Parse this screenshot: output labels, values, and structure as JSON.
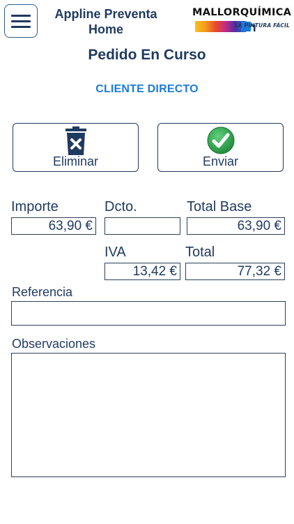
{
  "header": {
    "menu_icon": "hamburger-menu-icon",
    "app_title": "Appline Preventa Home",
    "logo": {
      "name": "MALLORQUÍMICA",
      "tagline": "LA PINTURA FÁCIL"
    }
  },
  "page_title": "Pedido En Curso",
  "client": "CLIENTE DIRECTO",
  "actions": {
    "delete_label": "Eliminar",
    "delete_icon": "trash-icon",
    "send_label": "Enviar",
    "send_icon": "check-circle-icon"
  },
  "totals": {
    "importe_label": "Importe",
    "importe_value": "63,90 €",
    "dcto_label": "Dcto.",
    "dcto_value": "",
    "total_base_label": "Total Base",
    "total_base_value": "63,90 €",
    "iva_label": "IVA",
    "iva_value": "13,42 €",
    "total_label": "Total",
    "total_value": "77,32 €"
  },
  "referencia": {
    "label": "Referencia",
    "value": ""
  },
  "observaciones": {
    "label": "Observaciones",
    "value": ""
  },
  "colors": {
    "primary": "#1f3a5f",
    "accent": "#1e7bd6",
    "delete_icon": "#1f3a5f",
    "send_icon": "#2fa84f"
  }
}
